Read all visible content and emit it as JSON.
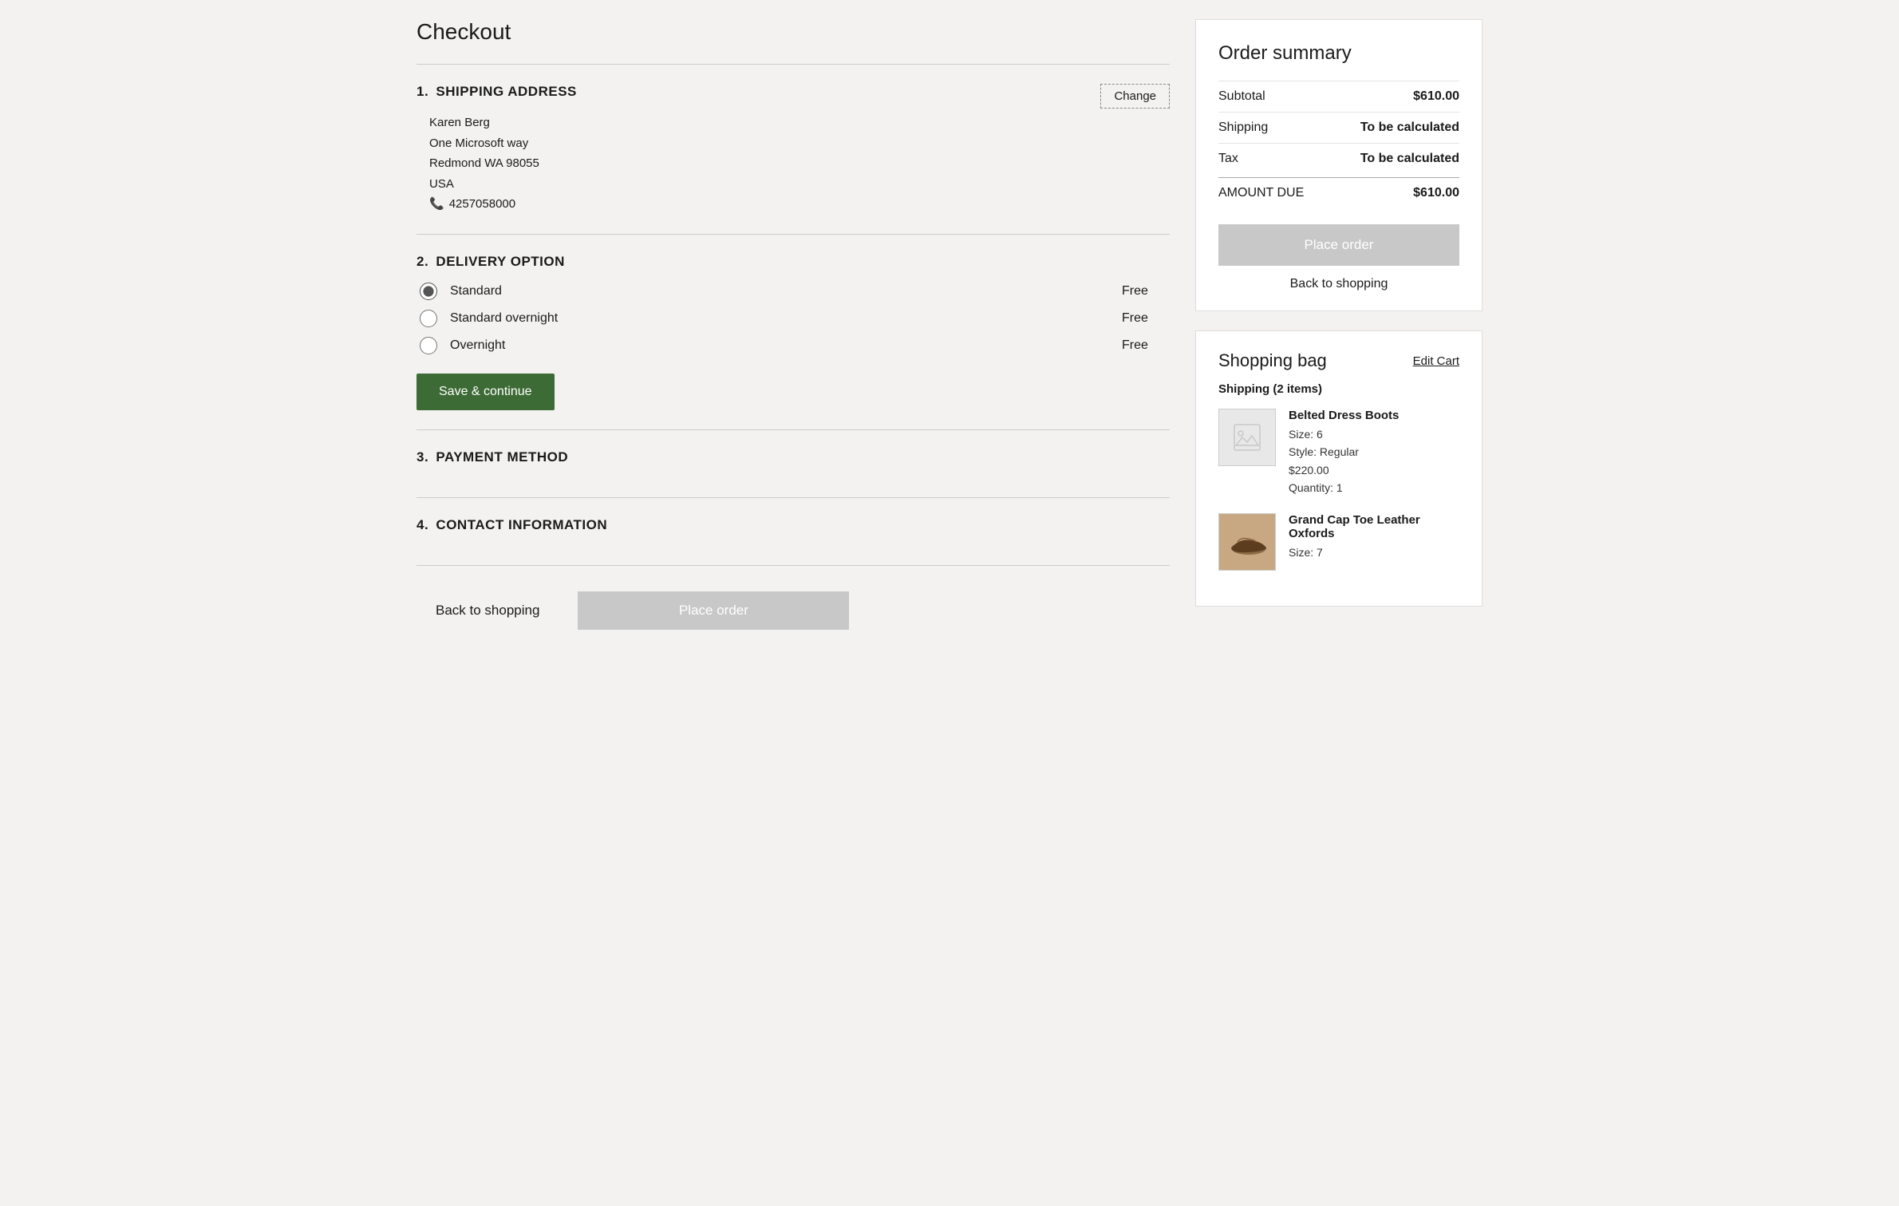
{
  "page": {
    "title": "Checkout"
  },
  "sections": {
    "shipping": {
      "step": "1.",
      "label": "SHIPPING ADDRESS",
      "change_btn": "Change",
      "address": {
        "name": "Karen Berg",
        "street": "One Microsoft way",
        "city_state_zip": "Redmond WA  98055",
        "country": "USA",
        "phone": "4257058000"
      }
    },
    "delivery": {
      "step": "2.",
      "label": "DELIVERY OPTION",
      "options": [
        {
          "id": "standard",
          "label": "Standard",
          "price": "Free",
          "checked": true
        },
        {
          "id": "standard-overnight",
          "label": "Standard overnight",
          "price": "Free",
          "checked": false
        },
        {
          "id": "overnight",
          "label": "Overnight",
          "price": "Free",
          "checked": false
        }
      ],
      "save_btn": "Save & continue"
    },
    "payment": {
      "step": "3.",
      "label": "PAYMENT METHOD"
    },
    "contact": {
      "step": "4.",
      "label": "CONTACT INFORMATION"
    }
  },
  "bottom_actions": {
    "back_label": "Back to shopping",
    "place_order_label": "Place order"
  },
  "order_summary": {
    "title": "Order summary",
    "subtotal_label": "Subtotal",
    "subtotal_value": "$610.00",
    "shipping_label": "Shipping",
    "shipping_value": "To be calculated",
    "tax_label": "Tax",
    "tax_value": "To be calculated",
    "amount_due_label": "AMOUNT DUE",
    "amount_due_value": "$610.00",
    "place_order_btn": "Place order",
    "back_to_shopping": "Back to shopping"
  },
  "shopping_bag": {
    "title": "Shopping bag",
    "edit_cart": "Edit Cart",
    "items_label": "Shipping (2 items)",
    "items": [
      {
        "name": "Belted Dress Boots",
        "size": "6",
        "style": "Regular",
        "price": "$220.00",
        "quantity": "1",
        "has_image": false
      },
      {
        "name": "Grand Cap Toe Leather Oxfords",
        "size": "7",
        "has_image": true
      }
    ]
  }
}
